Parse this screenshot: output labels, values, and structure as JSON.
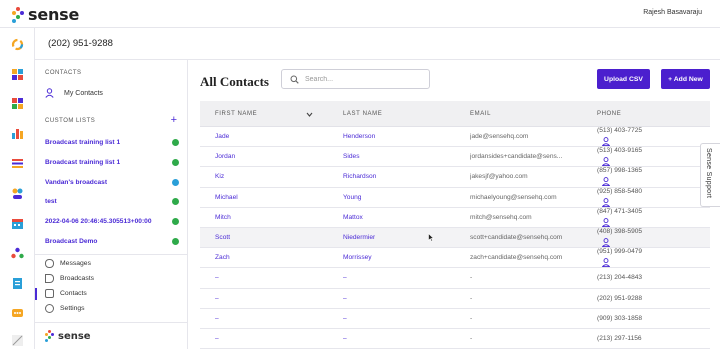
{
  "app": {
    "logo_text": "sense",
    "user_name": "Rajesh Basavaraju"
  },
  "header": {
    "phone": "(202) 951-9288"
  },
  "sidebar": {
    "contacts_label": "CONTACTS",
    "my_contacts": "My Contacts",
    "custom_lists_label": "CUSTOM LISTS",
    "add_symbol": "+",
    "custom_lists": [
      {
        "label": "Broadcast training list 1",
        "status_color": "#2faa4a"
      },
      {
        "label": "Broadcast training list 1",
        "status_color": "#2faa4a"
      },
      {
        "label": "Vandan's broadcast",
        "status_color": "#2a9fd8"
      },
      {
        "label": "test",
        "status_color": "#2faa4a"
      },
      {
        "label": "2022-04-06 20:46:45.305513+00:00",
        "status_color": "#2faa4a"
      },
      {
        "label": "Broadcast Demo",
        "status_color": "#2faa4a"
      }
    ],
    "nav": [
      {
        "label": "Messages",
        "icon": "message-icon"
      },
      {
        "label": "Broadcasts",
        "icon": "megaphone-icon"
      },
      {
        "label": "Contacts",
        "icon": "contacts-icon",
        "active": true
      },
      {
        "label": "Settings",
        "icon": "gear-icon"
      }
    ],
    "footer_logo": "sense"
  },
  "main": {
    "title": "All Contacts",
    "search_placeholder": "Search...",
    "upload_label": "Upload CSV",
    "add_label": "+ Add New",
    "columns": [
      "FIRST NAME",
      "LAST NAME",
      "EMAIL",
      "PHONE"
    ],
    "rows": [
      {
        "first": "Jade",
        "last": "Henderson",
        "email": "jade@sensehq.com",
        "phone": "(513) 403-7725"
      },
      {
        "first": "Jordan",
        "last": "Sides",
        "email": "jordansides+candidate@sens...",
        "phone": "(513) 403-9165"
      },
      {
        "first": "Kiz",
        "last": "Richardson",
        "email": "jakesjf@yahoo.com",
        "phone": "(857) 998-1365"
      },
      {
        "first": "Michael",
        "last": "Young",
        "email": "michaelyoung@sensehq.com",
        "phone": "(925) 858-5480"
      },
      {
        "first": "Mitch",
        "last": "Mattox",
        "email": "mitch@sensehq.com",
        "phone": "(847) 471-3405"
      },
      {
        "first": "Scott",
        "last": "Niedermier",
        "email": "scott+candidate@sensehq.com",
        "phone": "(408) 398-5905"
      },
      {
        "first": "Zach",
        "last": "Morrissey",
        "email": "zach+candidate@sensehq.com",
        "phone": "(951) 999-0479"
      },
      {
        "first": "–",
        "last": "–",
        "email": "-",
        "phone": "(213) 204-4843"
      },
      {
        "first": "–",
        "last": "–",
        "email": "-",
        "phone": "(202) 951-9288"
      },
      {
        "first": "–",
        "last": "–",
        "email": "-",
        "phone": "(909) 303-1858"
      },
      {
        "first": "–",
        "last": "–",
        "email": "-",
        "phone": "(213) 297-1156"
      }
    ]
  },
  "support": {
    "label": "Sense Support"
  },
  "colors": {
    "accent": "#4b1fce",
    "link": "#4b2bd6"
  }
}
